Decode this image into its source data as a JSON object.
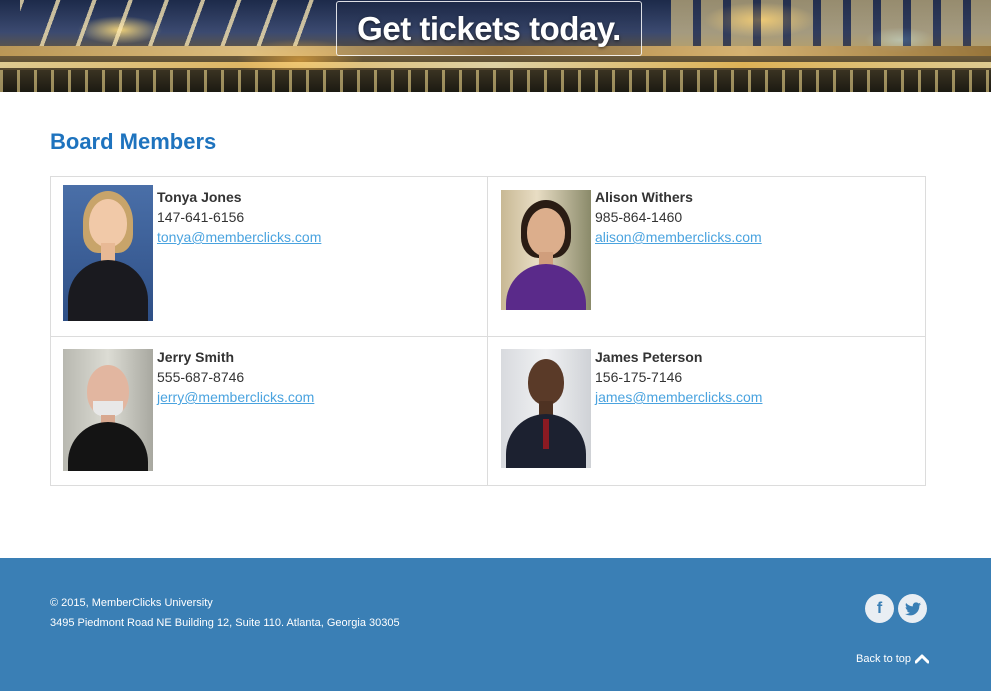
{
  "hero": {
    "cta_label": "Get tickets today."
  },
  "main": {
    "title": "Board Members",
    "members": [
      {
        "name": "Tonya Jones",
        "phone": "147-641-6156",
        "email": "tonya@memberclicks.com"
      },
      {
        "name": "Alison Withers",
        "phone": "985-864-1460",
        "email": "alison@memberclicks.com"
      },
      {
        "name": "Jerry Smith",
        "phone": "555-687-8746",
        "email": "jerry@memberclicks.com"
      },
      {
        "name": "James Peterson",
        "phone": "156-175-7146",
        "email": "james@memberclicks.com"
      }
    ]
  },
  "footer": {
    "copyright": "© 2015, MemberClicks University",
    "address": "3495 Piedmont Road NE Building 12, Suite 110. Atlanta, Georgia 30305",
    "back_to_top": "Back to top",
    "social": {
      "facebook_glyph": "f",
      "twitter_glyph": "t"
    }
  },
  "icons": [
    "facebook-icon",
    "twitter-icon",
    "chevron-up-icon"
  ],
  "colors": {
    "accent": "#1e73be",
    "link": "#4aa3df",
    "footer_bg": "#3a7fb5"
  }
}
